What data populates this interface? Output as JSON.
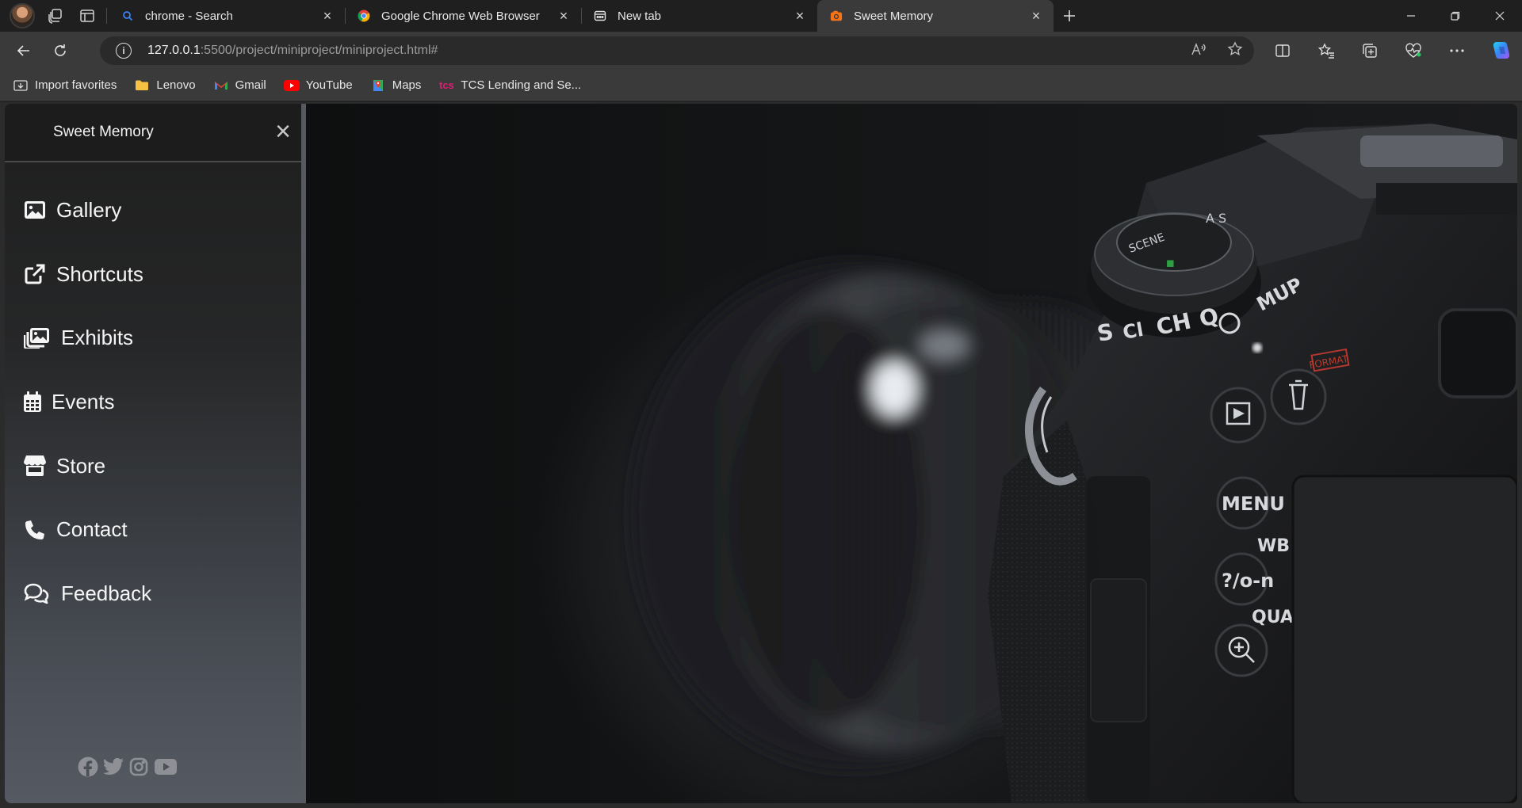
{
  "browser": {
    "tabs": [
      {
        "title": "chrome - Search",
        "favicon": "search-icon",
        "active": false
      },
      {
        "title": "Google Chrome Web Browser",
        "favicon": "chrome-logo-icon",
        "active": false
      },
      {
        "title": "New tab",
        "favicon": "new-tab-page-icon",
        "active": false
      },
      {
        "title": "Sweet Memory",
        "favicon": "camera-favicon-icon",
        "active": true
      }
    ],
    "address": {
      "host": "127.0.0.1",
      "path": ":5500/project/miniproject/miniproject.html#"
    },
    "bookmarks": [
      {
        "label": "Import favorites",
        "icon": "import-icon"
      },
      {
        "label": "Lenovo",
        "icon": "folder-icon"
      },
      {
        "label": "Gmail",
        "icon": "gmail-icon"
      },
      {
        "label": "YouTube",
        "icon": "youtube-icon"
      },
      {
        "label": "Maps",
        "icon": "maps-icon"
      },
      {
        "label": "TCS Lending and Se...",
        "icon": "tcs-icon"
      }
    ]
  },
  "sidebar": {
    "title": "Sweet Memory",
    "items": [
      {
        "label": "Gallery",
        "icon": "image-icon"
      },
      {
        "label": "Shortcuts",
        "icon": "external-link-icon"
      },
      {
        "label": "Exhibits",
        "icon": "images-icon"
      },
      {
        "label": "Events",
        "icon": "calendar-icon"
      },
      {
        "label": "Store",
        "icon": "store-icon"
      },
      {
        "label": "Contact",
        "icon": "phone-icon"
      },
      {
        "label": "Feedback",
        "icon": "comments-icon"
      }
    ],
    "socials": [
      "facebook-icon",
      "twitter-icon",
      "instagram-icon",
      "youtube-icon"
    ]
  },
  "hero": {
    "dial_labels": [
      "S",
      "Cl",
      "CH",
      "Q",
      "MUP"
    ],
    "buttons": [
      "MENU",
      "WB",
      "?/o-n",
      "QUAL"
    ],
    "format_label": "FORMAT"
  },
  "colors": {
    "accent": "#f97316",
    "sidebar_text": "#f5f5f5",
    "youtube_red": "#ff0000"
  }
}
